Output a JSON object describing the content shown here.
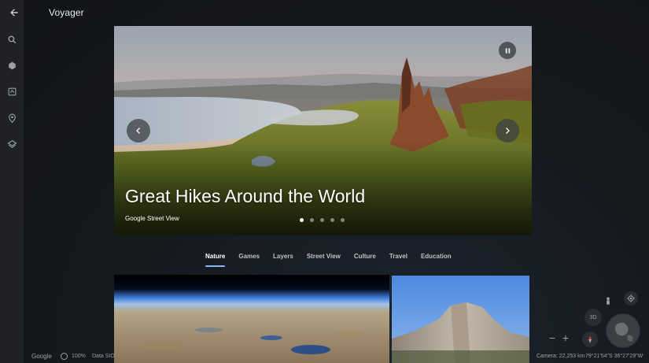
{
  "header": {
    "title": "Voyager"
  },
  "hero": {
    "title": "Great Hikes Around the World",
    "subtitle": "Google Street View",
    "slide_count": 5,
    "active_slide": 1
  },
  "tabs": [
    {
      "label": "Nature",
      "active": true
    },
    {
      "label": "Games",
      "active": false
    },
    {
      "label": "Layers",
      "active": false
    },
    {
      "label": "Street View",
      "active": false
    },
    {
      "label": "Culture",
      "active": false
    },
    {
      "label": "Travel",
      "active": false
    },
    {
      "label": "Education",
      "active": false
    }
  ],
  "rail": {
    "icons": [
      "search-icon",
      "dice-icon",
      "voyager-icon",
      "place-icon",
      "layers-icon"
    ]
  },
  "map_controls": {
    "threed_label": "3D",
    "zoom_out_label": "−",
    "zoom_in_label": "+"
  },
  "status": {
    "logo": "Google",
    "load_percent": "100%",
    "data_sio": "Data SIO",
    "camera": "Camera: 22,253 km",
    "coords": "79°21'54\"S 36°27'29\"W"
  },
  "colors": {
    "accent": "#8ab4f8",
    "rail": "#202124",
    "background": "#15171a"
  }
}
